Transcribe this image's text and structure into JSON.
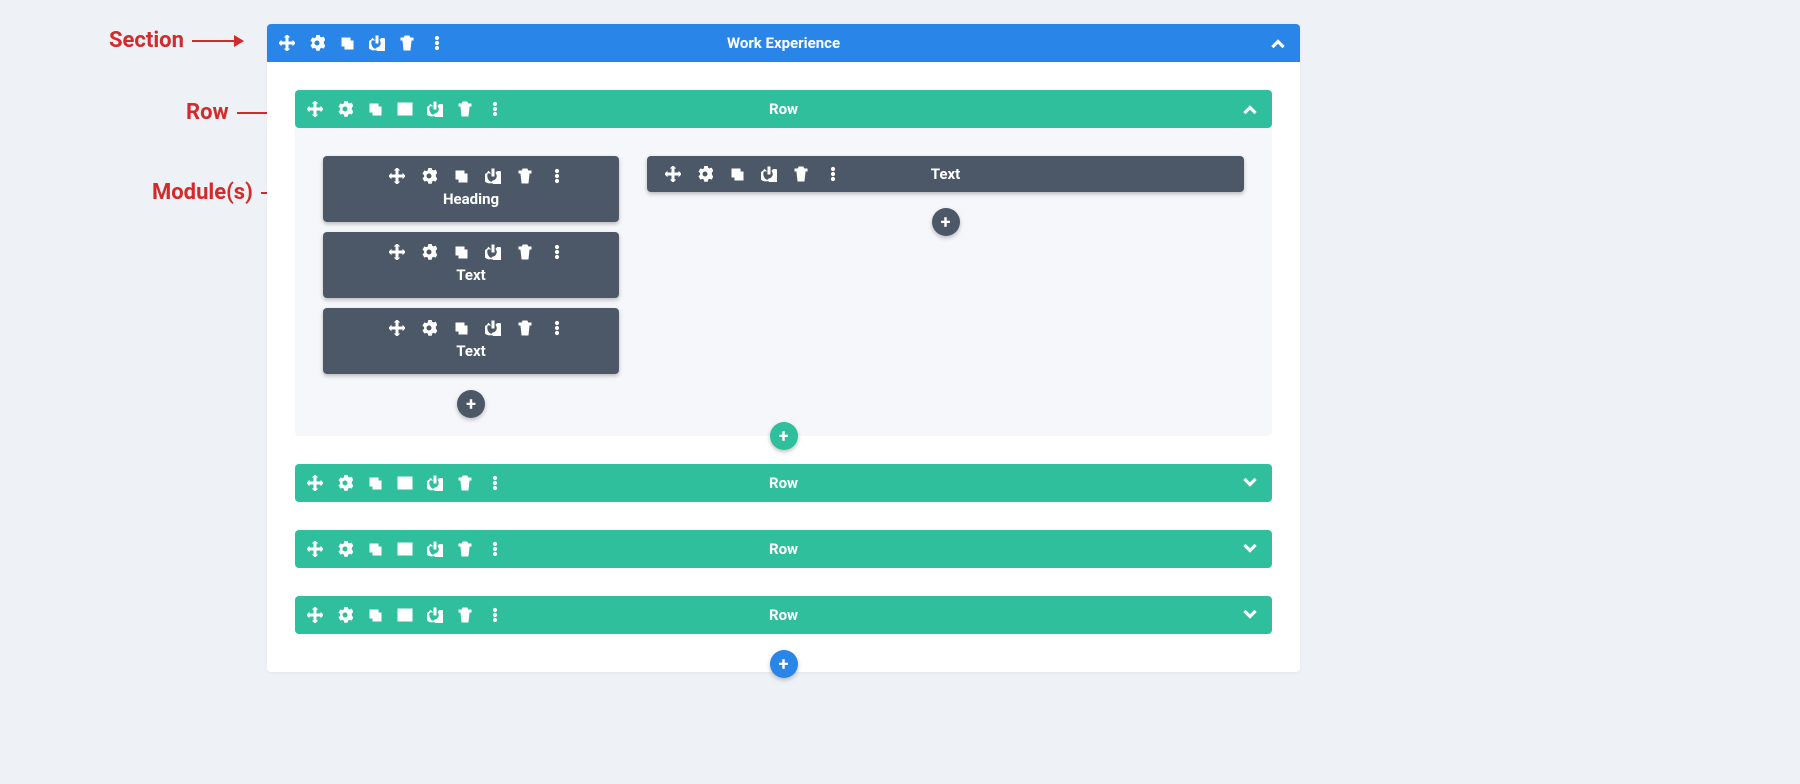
{
  "annotations": {
    "section": "Section",
    "row": "Row",
    "modules": "Module(s)"
  },
  "section": {
    "title": "Work Experience",
    "expanded": true
  },
  "rows": [
    {
      "label": "Row",
      "expanded": true,
      "columns": [
        {
          "modules": [
            {
              "label": "Heading"
            },
            {
              "label": "Text"
            },
            {
              "label": "Text"
            }
          ]
        },
        {
          "modules": [
            {
              "label": "Text"
            }
          ]
        }
      ]
    },
    {
      "label": "Row",
      "expanded": false
    },
    {
      "label": "Row",
      "expanded": false
    },
    {
      "label": "Row",
      "expanded": false
    }
  ],
  "icons": {
    "move": "move-icon",
    "gear": "gear-icon",
    "duplicate": "duplicate-icon",
    "columns": "columns-icon",
    "power": "power-icon",
    "trash": "trash-icon",
    "more": "more-vertical-icon",
    "chevron_up": "chevron-up-icon",
    "chevron_down": "chevron-down-icon",
    "plus": "plus-icon"
  },
  "colors": {
    "section_bar": "#2a85e8",
    "row_bar": "#2fbf9d",
    "module_bg": "#4c5868",
    "page_bg": "#eef1f6",
    "annotation": "#d32b2b"
  }
}
